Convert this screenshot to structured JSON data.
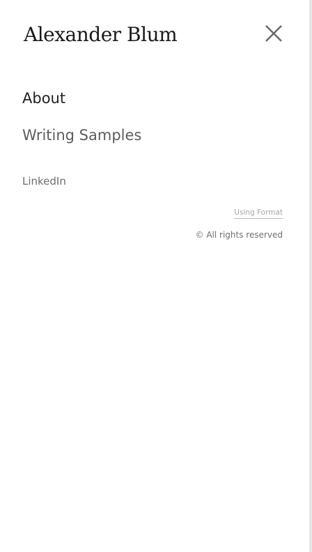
{
  "header": {
    "site_title": "Alexander Blum",
    "close_icon": "close-icon"
  },
  "nav": {
    "items": [
      {
        "label": "About",
        "active": true
      },
      {
        "label": "Writing Samples",
        "active": false
      }
    ]
  },
  "social": {
    "linkedin_label": "LinkedIn"
  },
  "footer": {
    "using_format_label": "Using Format",
    "copyright": "© All rights reserved"
  },
  "colors": {
    "background": "#ffffff",
    "title": "#1a1a1a",
    "nav_active": "#1f1f1f",
    "nav_inactive": "#5c5c5c",
    "muted": "#a6a6a6"
  }
}
